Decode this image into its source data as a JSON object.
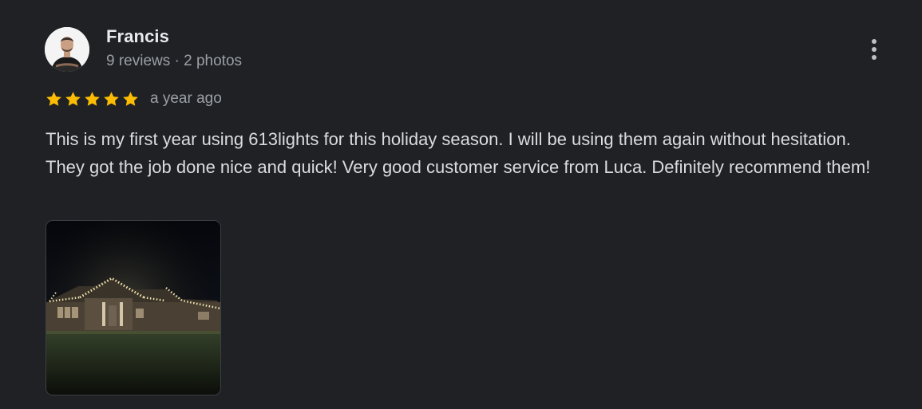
{
  "review": {
    "author": {
      "name": "Francis",
      "meta": "9 reviews · 2 photos"
    },
    "rating": 5,
    "rating_max": 5,
    "time": "a year ago",
    "text": "This is my first year using 613lights for this holiday season. I will be using them again without hesitation. They got the job done nice and quick! Very good customer service from Luca. Definitely recommend them!",
    "photo_count": 1
  },
  "colors": {
    "background": "#202124",
    "star": "#fbbc04",
    "primary_text": "#e8eaed",
    "secondary_text": "#9aa0a6"
  },
  "icons": {
    "menu": "more-vert-icon",
    "star": "star-icon"
  }
}
